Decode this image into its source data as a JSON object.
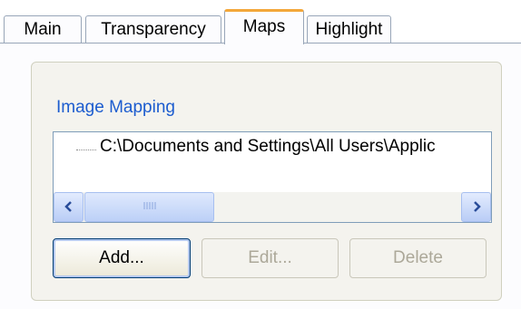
{
  "tabs": [
    {
      "label": "Main",
      "active": false
    },
    {
      "label": "Transparency",
      "active": false
    },
    {
      "label": "Maps",
      "active": true
    },
    {
      "label": "Highlight",
      "active": false
    }
  ],
  "image_mapping": {
    "group_label": "Image Mapping",
    "items": [
      "C:\\Documents and Settings\\All Users\\Applic"
    ],
    "scrollbar": {
      "left_icon": "chevron-left-icon",
      "right_icon": "chevron-right-icon",
      "grip_icon": "grip-icon"
    }
  },
  "buttons": {
    "add_label": "Add...",
    "edit_label": "Edit...",
    "delete_label": "Delete"
  },
  "colors": {
    "accent": "#f3a73a",
    "group_label": "#1c5ccf",
    "panel_bg": "#f4f3ee"
  }
}
